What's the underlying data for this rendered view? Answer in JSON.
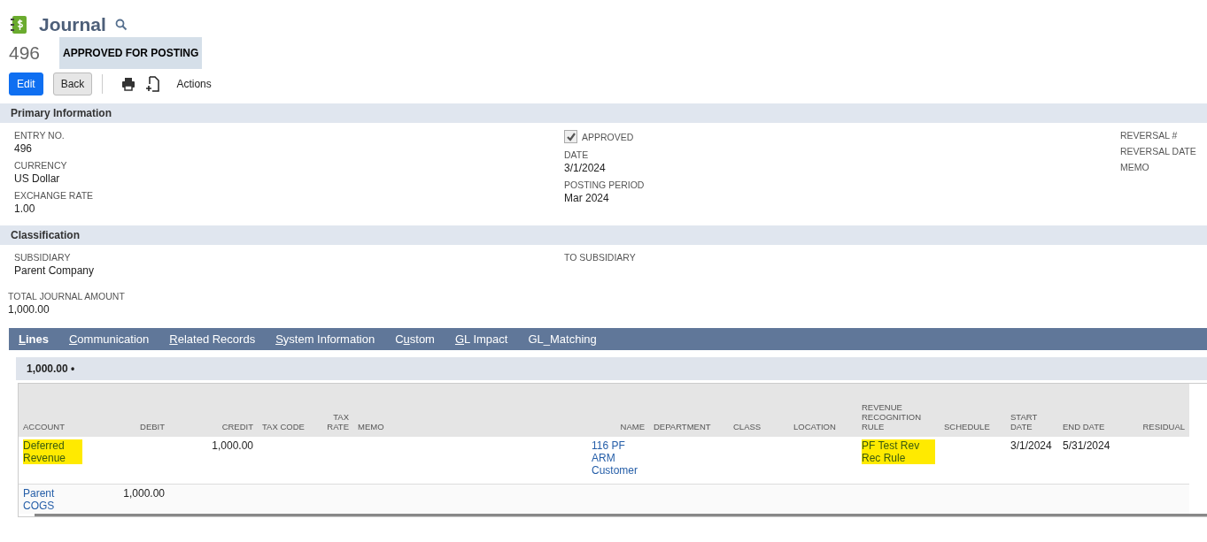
{
  "header": {
    "title": "Journal",
    "number": "496",
    "status": "APPROVED FOR POSTING"
  },
  "buttons": [
    {
      "label": "Edit",
      "kind": "primary"
    },
    {
      "label": "Back",
      "kind": "secondary"
    }
  ],
  "toolbar": {
    "actions_label": "Actions"
  },
  "sections": [
    {
      "title": "Primary Information",
      "columns": [
        [
          {
            "kind": "field",
            "label": "ENTRY NO.",
            "value": "496"
          },
          {
            "kind": "field",
            "label": "CURRENCY",
            "value": "US Dollar"
          },
          {
            "kind": "field",
            "label": "EXCHANGE RATE",
            "value": "1.00"
          }
        ],
        [
          {
            "kind": "checkbox",
            "label": "APPROVED",
            "checked": true
          },
          {
            "kind": "field",
            "label": "DATE",
            "value": "3/1/2024"
          },
          {
            "kind": "field",
            "label": "POSTING PERIOD",
            "value": "Mar 2024"
          }
        ],
        [
          {
            "kind": "field",
            "label": "REVERSAL #"
          },
          {
            "kind": "field",
            "label": "REVERSAL DATE"
          },
          {
            "kind": "field",
            "label": "MEMO"
          }
        ]
      ]
    },
    {
      "title": "Classification",
      "columns": [
        [
          {
            "kind": "field",
            "label": "SUBSIDIARY",
            "value": "Parent Company"
          }
        ],
        [
          {
            "kind": "field",
            "label": "TO SUBSIDIARY"
          }
        ]
      ]
    }
  ],
  "total": {
    "label": "TOTAL JOURNAL AMOUNT",
    "value": "1,000.00"
  },
  "tabs": [
    {
      "mnemonic": "L",
      "suffix": "ines",
      "selected": true
    },
    {
      "mnemonic": "C",
      "suffix": "ommunication",
      "selected": false
    },
    {
      "mnemonic": "R",
      "suffix": "elated Records",
      "selected": false
    },
    {
      "mnemonic": "S",
      "suffix": "ystem Information",
      "selected": false
    },
    {
      "prefix": "C",
      "mnemonic": "u",
      "suffix": "stom",
      "selected": false
    },
    {
      "mnemonic": "G",
      "suffix": "L Impact",
      "selected": false
    },
    {
      "prefix": "GL_Matching",
      "selected": false
    }
  ],
  "subtab": {
    "label": "1,000.00 •"
  },
  "table": {
    "columns": [
      "ACCOUNT",
      "DEBIT",
      "CREDIT",
      "TAX CODE",
      "TAX RATE",
      "MEMO",
      "NAME",
      "DEPARTMENT",
      "CLASS",
      "LOCATION",
      "REVENUE RECOGNITION RULE",
      "SCHEDULE",
      "START DATE",
      "END DATE",
      "RESIDUAL"
    ],
    "rows": [
      {
        "cells": [
          {
            "text": "Deferred Revenue",
            "kind": "link",
            "highlighted": true
          },
          null,
          {
            "text": "1,000.00",
            "kind": "text",
            "highlighted": false
          },
          null,
          null,
          null,
          {
            "text": "116 PF ARM Customer",
            "kind": "link",
            "highlighted": false
          },
          null,
          null,
          null,
          {
            "text": "PF Test Rev Rec Rule",
            "kind": "link",
            "highlighted": true
          },
          null,
          {
            "text": "3/1/2024",
            "kind": "text",
            "highlighted": false
          },
          {
            "text": "5/31/2024",
            "kind": "text",
            "highlighted": false
          },
          null
        ]
      },
      {
        "cells": [
          {
            "text": "Parent COGS",
            "kind": "link",
            "highlighted": false
          },
          {
            "text": "1,000.00",
            "kind": "text",
            "highlighted": false
          }
        ]
      }
    ]
  }
}
